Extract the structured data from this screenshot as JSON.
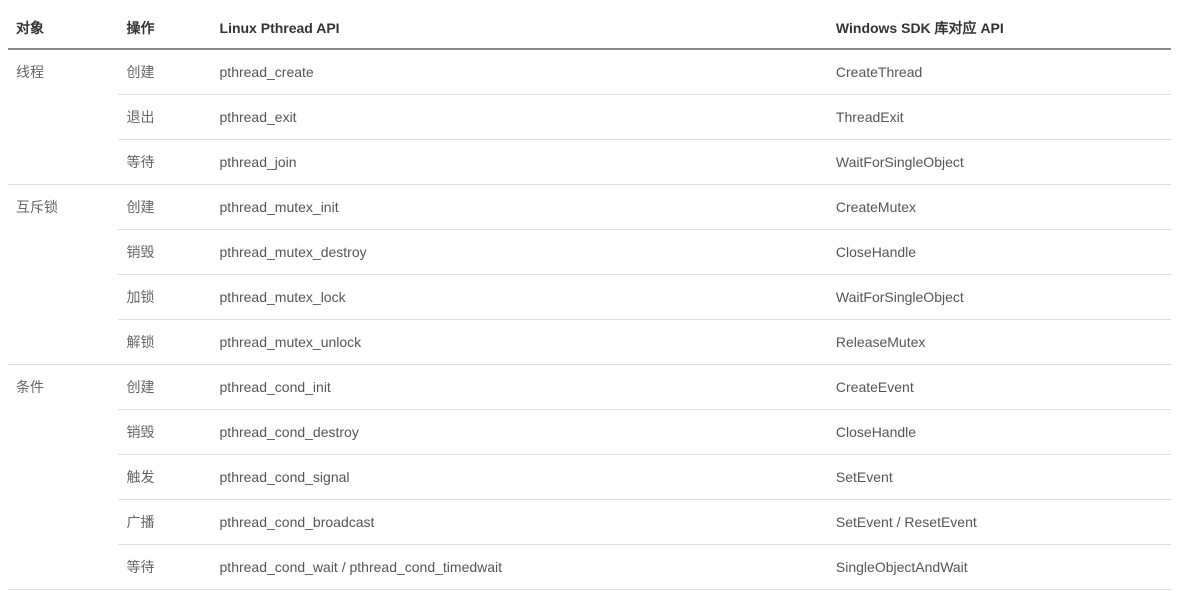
{
  "headers": {
    "object": "对象",
    "operation": "操作",
    "linux": "Linux Pthread API",
    "windows": "Windows SDK 库对应 API"
  },
  "groups": [
    {
      "object": "线程",
      "rows": [
        {
          "op": "创建",
          "linux": "pthread_create",
          "win": "CreateThread"
        },
        {
          "op": "退出",
          "linux": "pthread_exit",
          "win": "ThreadExit"
        },
        {
          "op": "等待",
          "linux": "pthread_join",
          "win": "WaitForSingleObject"
        }
      ]
    },
    {
      "object": "互斥锁",
      "rows": [
        {
          "op": "创建",
          "linux": "pthread_mutex_init",
          "win": "CreateMutex"
        },
        {
          "op": "销毁",
          "linux": "pthread_mutex_destroy",
          "win": "CloseHandle"
        },
        {
          "op": "加锁",
          "linux": "pthread_mutex_lock",
          "win": "WaitForSingleObject"
        },
        {
          "op": "解锁",
          "linux": "pthread_mutex_unlock",
          "win": "ReleaseMutex"
        }
      ]
    },
    {
      "object": "条件",
      "rows": [
        {
          "op": "创建",
          "linux": "pthread_cond_init",
          "win": "CreateEvent"
        },
        {
          "op": "销毁",
          "linux": "pthread_cond_destroy",
          "win": "CloseHandle"
        },
        {
          "op": "触发",
          "linux": "pthread_cond_signal",
          "win": "SetEvent"
        },
        {
          "op": "广播",
          "linux": "pthread_cond_broadcast",
          "win": "SetEvent / ResetEvent"
        },
        {
          "op": "等待",
          "linux": "pthread_cond_wait / pthread_cond_timedwait",
          "win": "SingleObjectAndWait"
        }
      ]
    }
  ]
}
